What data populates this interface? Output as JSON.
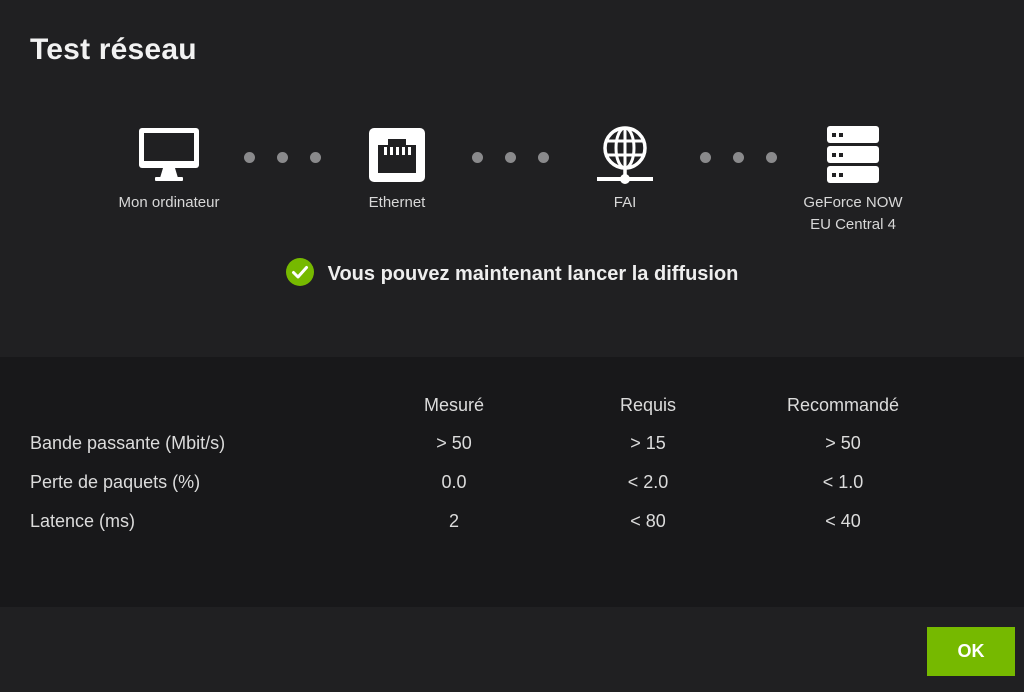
{
  "dialog": {
    "title": "Test réseau"
  },
  "diagram": {
    "nodes": [
      {
        "label": "Mon ordinateur",
        "icon": "monitor-icon"
      },
      {
        "label": "Ethernet",
        "icon": "ethernet-port-icon"
      },
      {
        "label": "FAI",
        "icon": "globe-network-icon"
      },
      {
        "label": "GeForce NOW",
        "label2": "EU Central 4",
        "icon": "server-rack-icon"
      }
    ]
  },
  "status": {
    "message": "Vous pouvez maintenant lancer la diffusion",
    "icon": "check-circle-icon",
    "color": "#76b900"
  },
  "stats": {
    "columns": [
      "Mesuré",
      "Requis",
      "Recommandé"
    ],
    "rows": [
      {
        "label": "Bande passante (Mbit/s)",
        "values": [
          "> 50",
          "> 15",
          "> 50"
        ]
      },
      {
        "label": "Perte de paquets (%)",
        "values": [
          "0.0",
          "< 2.0",
          "< 1.0"
        ]
      },
      {
        "label": "Latence (ms)",
        "values": [
          "2",
          "< 80",
          "< 40"
        ]
      }
    ]
  },
  "actions": {
    "ok_label": "OK",
    "accent": "#76b900"
  }
}
